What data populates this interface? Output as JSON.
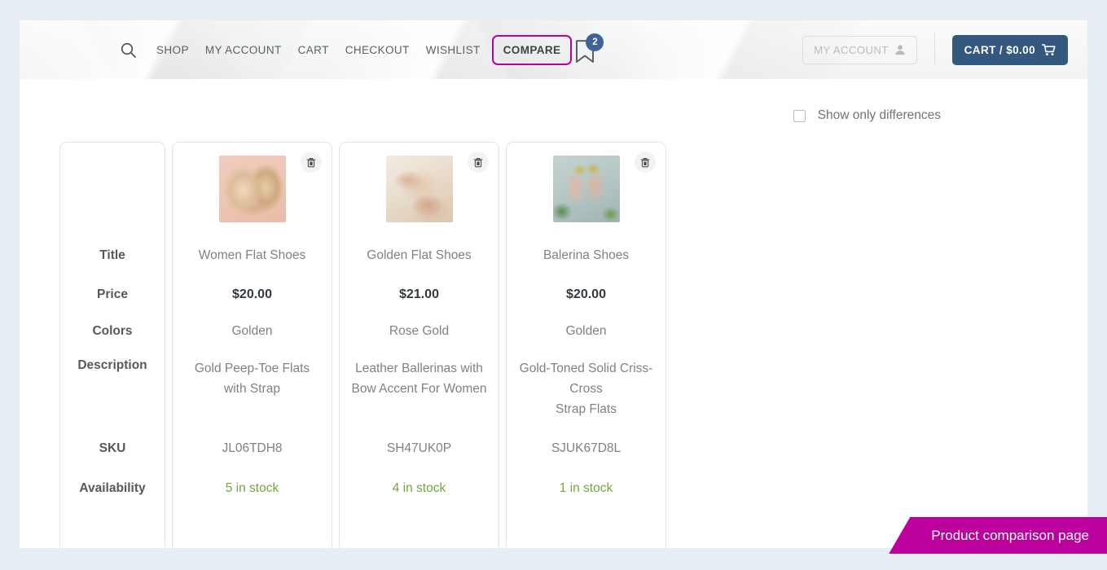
{
  "header": {
    "search_icon": "search-icon",
    "nav": [
      {
        "label": "SHOP"
      },
      {
        "label": "MY ACCOUNT"
      },
      {
        "label": "CART"
      },
      {
        "label": "CHECKOUT"
      },
      {
        "label": "WISHLIST"
      },
      {
        "label": "COMPARE"
      }
    ],
    "compare_badge_count": "2",
    "compare_icon": "bookmark-icon",
    "account_button": {
      "label": "MY ACCOUNT",
      "icon": "user-icon"
    },
    "cart_button": {
      "label": "CART / $0.00",
      "icon": "cart-icon"
    },
    "accent_color": "#bb009e",
    "cart_color": "#35587f",
    "badge_color": "#3d6596"
  },
  "toolbar": {
    "show_only_differences": "Show only differences",
    "checked": false
  },
  "compare_table": {
    "row_labels": {
      "title": "Title",
      "price": "Price",
      "colors": "Colors",
      "description": "Description",
      "sku": "SKU",
      "availability": "Availability"
    },
    "remove_icon": "trash-icon",
    "stock_color": "#74a542",
    "products": [
      {
        "image_alt": "gold-peep-toe-flats-thumbnail",
        "title": "Women Flat Shoes",
        "price": "$20.00",
        "colors": "Golden",
        "description": "Gold Peep-Toe Flats with Strap",
        "sku": "JL06TDH8",
        "availability": "5 in stock"
      },
      {
        "image_alt": "rose-gold-bow-ballerinas-thumbnail",
        "title": "Golden Flat Shoes",
        "price": "$21.00",
        "colors": "Rose Gold",
        "description": "Leather Ballerinas with Bow Accent For Women",
        "sku": "SH47UK0P",
        "availability": "4 in stock"
      },
      {
        "image_alt": "criss-cross-strap-flats-thumbnail",
        "title": "Balerina Shoes",
        "price": "$20.00",
        "colors": "Golden",
        "description": "Gold-Toned Solid Criss-Cross\nStrap Flats",
        "sku": "SJUK67D8L",
        "availability": "1 in stock"
      }
    ]
  },
  "corner_banner": {
    "label": "Product comparison page",
    "color": "#bb009e"
  }
}
